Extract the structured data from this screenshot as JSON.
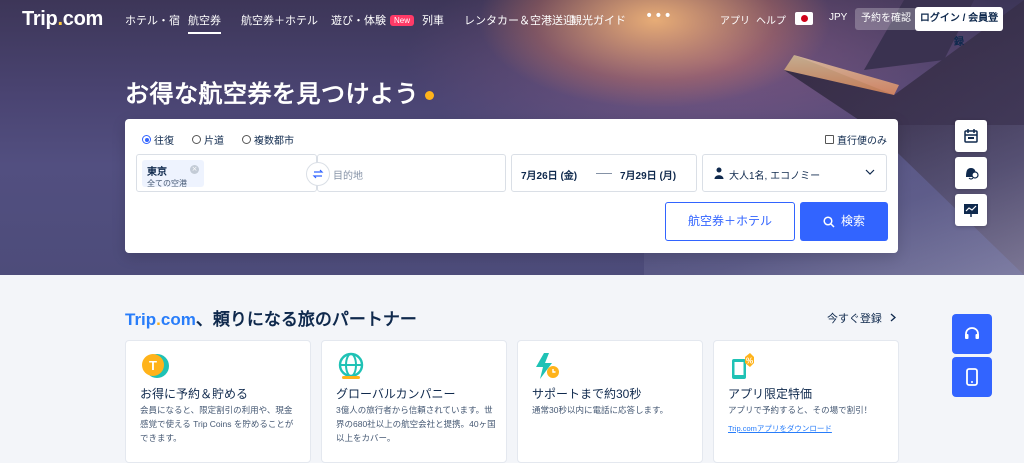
{
  "nav": {
    "logo_main": "Trip",
    "logo_dot": ".",
    "logo_tail": "com",
    "items": [
      {
        "label": "ホテル・宿"
      },
      {
        "label": "航空券"
      },
      {
        "label": "航空券＋ホテル"
      },
      {
        "label": "遊び・体験",
        "badge": "New"
      },
      {
        "label": "列車"
      },
      {
        "label": "レンタカー＆空港送迎"
      },
      {
        "label": "観光ガイド"
      }
    ],
    "more": "•••",
    "app": "アプリ",
    "help": "ヘルプ",
    "currency": "JPY",
    "booking": "予約を確認",
    "login": "ログイン / 会員登録"
  },
  "hero": {
    "headline": "お得な航空券を見つけよう"
  },
  "search": {
    "trip_types": [
      "往復",
      "片道",
      "複数都市"
    ],
    "selected_trip_type": "往復",
    "direct_only": "直行便のみ",
    "from_city": "東京",
    "from_sub": "全ての空港",
    "to_placeholder": "目的地",
    "depart_date": "7月26日 (金)",
    "return_date": "7月29日 (月)",
    "passengers": "大人1名, エコノミー",
    "combo_button": "航空券＋ホテル",
    "search_button": "検索"
  },
  "partner": {
    "brand": "Trip",
    "brand_dot": ".",
    "brand_tail": "com",
    "title_rest": "、頼りになる旅のパートナー",
    "register": "今すぐ登録"
  },
  "features": [
    {
      "title": "お得に予約＆貯める",
      "desc": "会員になると、限定割引の利用や、現金感覚で使える Trip Coins を貯めることができます。",
      "icon": "coin-icon"
    },
    {
      "title": "グローバルカンパニー",
      "desc": "3億人の旅行者から信頼されています。世界の680社以上の航空会社と提携。40ヶ国以上をカバー。",
      "icon": "globe-icon"
    },
    {
      "title": "サポートまで約30秒",
      "desc": "通常30秒以内に電話に応答します。",
      "icon": "lightning-clock-icon"
    },
    {
      "title": "アプリ限定特価",
      "desc": "アプリで予約すると、その場で割引！",
      "link": "Trip.comアプリをダウンロード",
      "icon": "app-discount-icon"
    }
  ],
  "colors": {
    "primary": "#3264ff",
    "brand_blue": "#287dfa",
    "accent_yellow": "#ffb31a",
    "badge_pink": "#ff3a67",
    "text_dark": "#0f294d"
  }
}
